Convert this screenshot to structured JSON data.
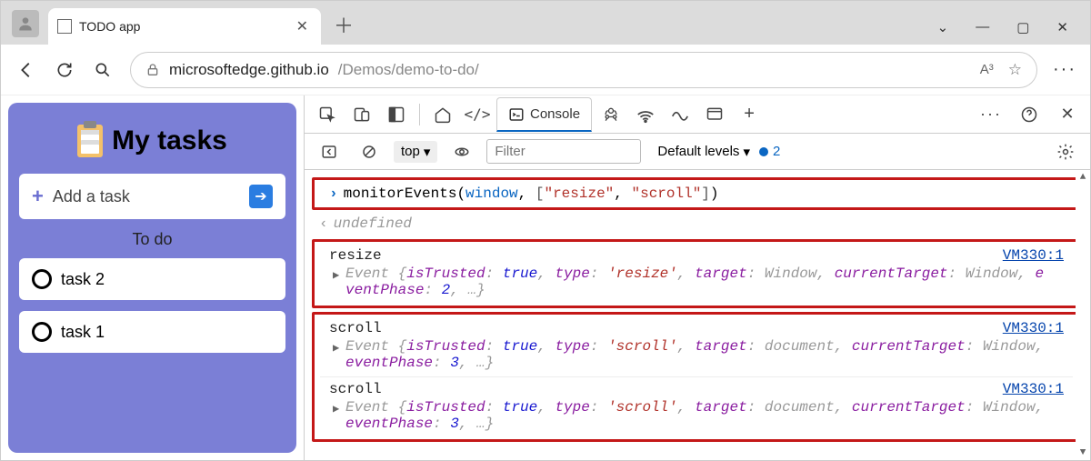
{
  "browser": {
    "tab_title": "TODO app",
    "url_domain": "microsoftedge.github.io",
    "url_path": "/Demos/demo-to-do/",
    "translator_label": "A³"
  },
  "app": {
    "title": "My tasks",
    "add_label": "Add a task",
    "section_label": "To do",
    "tasks": [
      "task 2",
      "task 1"
    ]
  },
  "devtools": {
    "console_tab": "Console",
    "context": "top",
    "filter_placeholder": "Filter",
    "levels_label": "Default levels",
    "issues_count": "2",
    "command": {
      "fn": "monitorEvents",
      "arg_target": "window",
      "bracket_open": "[",
      "str1": "\"resize\"",
      "comma": ", ",
      "str2": "\"scroll\"",
      "bracket_close": "]"
    },
    "return_value": "undefined",
    "events": [
      {
        "name": "resize",
        "vm": "VM330:1",
        "props": "Event {isTrusted: true, type: 'resize', target: Window, currentTarget: Window, eventPhase: 2, …}"
      },
      {
        "name": "scroll",
        "vm": "VM330:1",
        "props": "Event {isTrusted: true, type: 'scroll', target: document, currentTarget: Window, eventPhase: 3, …}"
      },
      {
        "name": "scroll",
        "vm": "VM330:1",
        "props": "Event {isTrusted: true, type: 'scroll', target: document, currentTarget: Window, eventPhase: 3, …}"
      }
    ]
  }
}
